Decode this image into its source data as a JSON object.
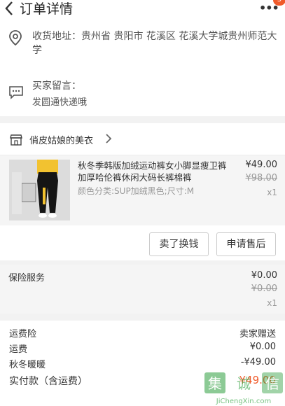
{
  "header": {
    "title": "订单详情",
    "more": "•••",
    "badge": "5"
  },
  "address": {
    "text": "收货地址：贵州省 贵阳市 花溪区 花溪大学城贵州师范大学"
  },
  "message": {
    "label": "买家留言：",
    "text": "发圆通快递哦"
  },
  "shop": {
    "name": "俏皮姑娘的美衣"
  },
  "product": {
    "title": "秋冬季韩版加绒运动裤女小脚显瘦卫裤加厚哈伦裤休闲大码长裤棉裤",
    "sku": "颜色分类:SUP加绒黑色;尺寸:M",
    "price": "¥49.00",
    "original_price": "¥98.00",
    "quantity": "x1"
  },
  "actions": {
    "sell": "卖了换钱",
    "after_sale": "申请售后"
  },
  "insurance": {
    "label": "保险服务",
    "price": "¥0.00",
    "original_price": "¥0.00",
    "quantity": "x1"
  },
  "summary": {
    "rows": [
      {
        "label": "运费险",
        "value": "卖家赠送"
      },
      {
        "label": "运费",
        "value": "¥0.00"
      },
      {
        "label": "秋冬暖暖",
        "value": "-¥49.00"
      }
    ],
    "total_label": "实付款（含运费）",
    "total_value": "¥49.00"
  },
  "watermark": {
    "text": "集 诚 信",
    "url": "JiChengXin.com"
  },
  "colors": {
    "accent": "#f05a2a",
    "background": "#f2f2f2"
  }
}
